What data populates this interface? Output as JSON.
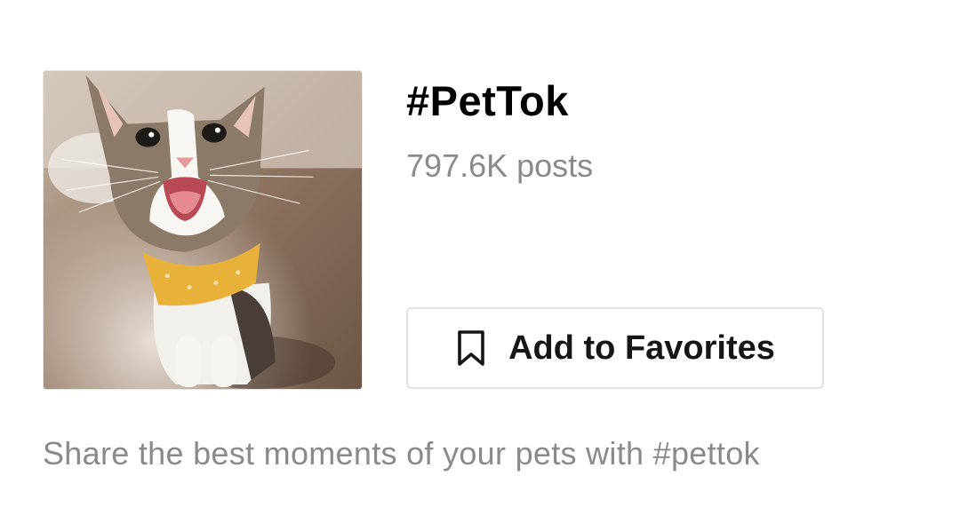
{
  "hashtag": {
    "title": "#PetTok",
    "post_count": "797.6K posts",
    "cover_image": "cat-with-yellow-bandana-photo"
  },
  "actions": {
    "favorite_label": "Add to Favorites",
    "favorite_icon": "bookmark-icon"
  },
  "description": "Share the best moments of your pets with #pettok",
  "colors": {
    "title": "#000000",
    "secondary_text": "#8a8a8a",
    "button_border": "#e2e2e2",
    "bandana": "#e8b23a"
  }
}
